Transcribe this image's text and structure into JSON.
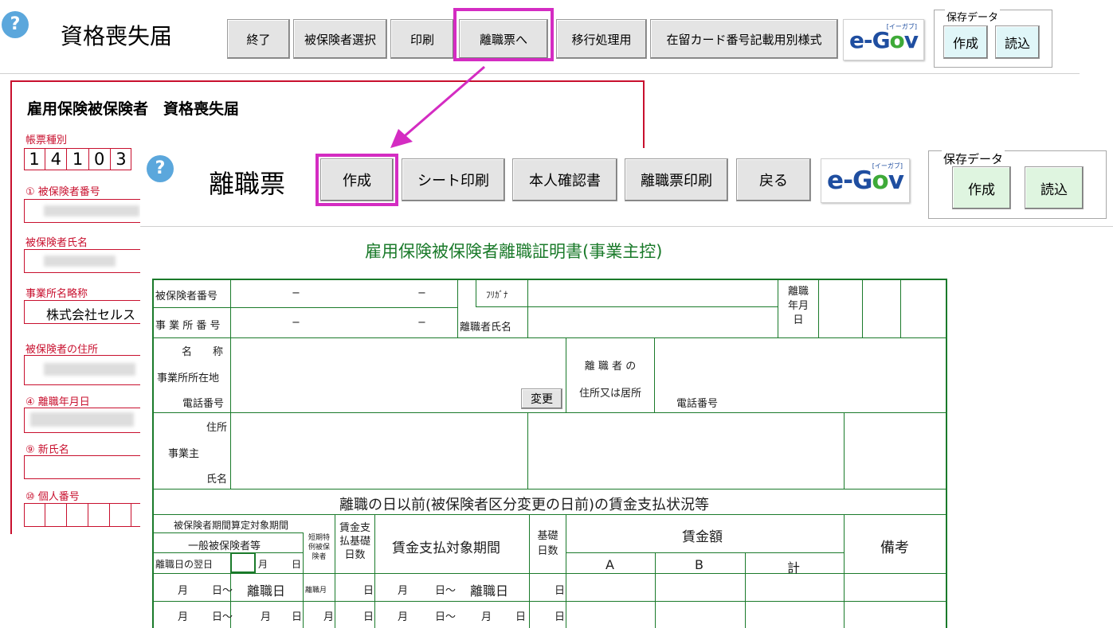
{
  "back": {
    "help": "?",
    "title": "資格喪失届",
    "toolbar": [
      "終了",
      "被保険者選択",
      "印刷",
      "離職票へ",
      "移行処理用",
      "在留カード番号記載用別様式"
    ],
    "save_group": {
      "label": "保存データ",
      "create": "作成",
      "load": "読込"
    },
    "form": {
      "title": "雇用保険被保険者　資格喪失届",
      "form_type_label": "帳票種別",
      "form_type_digits": [
        "1",
        "4",
        "1",
        "0",
        "3"
      ],
      "insured_no_label": "① 被保険者番号",
      "name_label": "被保険者氏名",
      "office_short_label": "事業所名略称",
      "office_short_value": "株式会社セルス",
      "address_label": "被保険者の住所",
      "leave_date_label": "④ 離職年月日",
      "new_name_label": "⑨ 新氏名",
      "personal_no_label": "⑩ 個人番号"
    }
  },
  "front": {
    "help": "?",
    "title": "離職票",
    "toolbar": [
      "作成",
      "シート印刷",
      "本人確認書",
      "離職票印刷",
      "戻る"
    ],
    "save_group": {
      "label": "保存データ",
      "create": "作成",
      "load": "読込"
    }
  },
  "egov": {
    "e": "e-",
    "g": "G",
    "o": "o",
    "v": "v",
    "sup": "[イーガブ]"
  },
  "sheet": {
    "title": "雇用保険被保険者離職証明書(事業主控)",
    "insured_no": "被保険者番号",
    "office_no": "事 業 所 番 号",
    "dash": "−",
    "furigana": "ﾌﾘｶﾞﾅ",
    "leaver_name": "離職者氏名",
    "leave_date": [
      "離職",
      "年月",
      "日"
    ],
    "name": "名　　称",
    "office_addr": "事業所所在地",
    "phone": "電話番号",
    "change": "変更",
    "leaver_addr": [
      "離 職 者 の",
      "住所又は居所"
    ],
    "phone2": "電話番号",
    "employer_addr": "住所",
    "employer": "事業主",
    "employer_name": "氏名",
    "section": "離職の日以前(被保険者区分変更の日前)の賃金支払状況等",
    "h_period": "被保険者期間算定対象期間",
    "h_general": "一般被保険者等",
    "h_short": [
      "短期特",
      "例被保",
      "険者"
    ],
    "h_nextday": "離職日の翌日",
    "h_month": "月",
    "h_day": "日",
    "h_wagedays": [
      "賃金支",
      "払基礎",
      "日数"
    ],
    "h_payperiod": "賃金支払対象期間",
    "h_basedays": [
      "基礎",
      "日数"
    ],
    "h_wage": "賃金額",
    "h_a": "A",
    "h_b": "B",
    "h_total": "計",
    "h_remarks": "備考",
    "r1": {
      "m": "月",
      "d": "日〜",
      "leave": "離職日",
      "lm": "離職月",
      "day": "日",
      "m2": "月",
      "d2": "日〜",
      "leave2": "離職日",
      "bd": "日"
    },
    "r2": {
      "m": "月",
      "d": "日〜",
      "m1": "月",
      "d1": "日",
      "sm": "月",
      "day": "日",
      "m2": "月",
      "d2": "日〜",
      "m3": "月",
      "d3": "日",
      "bd": "日"
    }
  }
}
